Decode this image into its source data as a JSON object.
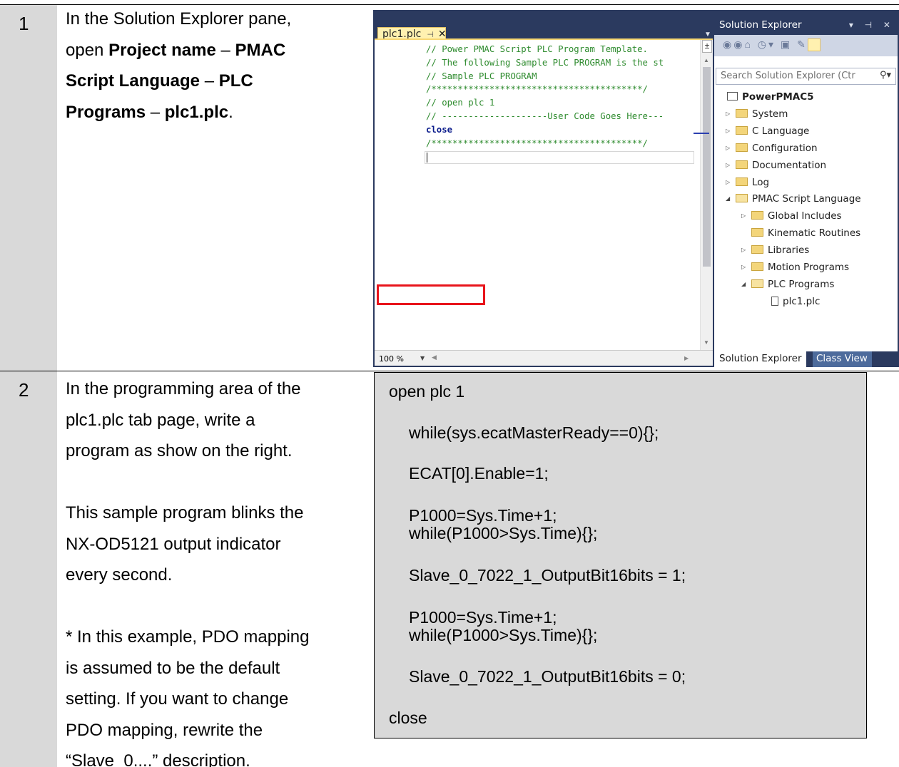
{
  "steps": [
    {
      "number": "1",
      "text_line1": "In the Solution Explorer pane,",
      "text_line2_pre": "open ",
      "text_line2_bold": "Project name",
      "text_sep1": " – ",
      "text_bold2": "PMAC",
      "text_line3_bold": "Script Language",
      "text_sep2": " – ",
      "text_bold3": "PLC",
      "text_line4_bold1": "Programs",
      "text_sep3": " – ",
      "text_line4_bold2": "plc1.plc",
      "text_line4_end": "."
    },
    {
      "number": "2",
      "lines": [
        "In the programming area of the",
        "plc1.plc tab page, write a",
        "program as show on the right.",
        "",
        "This sample program blinks the",
        "NX-OD5121 output indicator",
        "every second.",
        "",
        "* In this example, PDO mapping",
        "is assumed to be the default",
        "setting. If you want to change",
        "PDO mapping, rewrite the",
        "“Slave_0....” description."
      ]
    }
  ],
  "ide": {
    "tab_label": "plc1.plc",
    "tab_pin": "⊣",
    "tab_close": "✕",
    "code_lines": [
      {
        "text": "// Power PMAC Script PLC Program Template.",
        "kind": "c"
      },
      {
        "text": "// The following Sample PLC PROGRAM is the st",
        "kind": "c"
      },
      {
        "text": "// Sample PLC PROGRAM",
        "kind": "c"
      },
      {
        "text": "/****************************************/",
        "kind": "c"
      },
      {
        "text": "// open plc 1",
        "kind": "c"
      },
      {
        "text": "// --------------------User Code Goes Here---",
        "kind": "c"
      },
      {
        "text": "close",
        "kind": "k"
      },
      {
        "text": "/****************************************/",
        "kind": "c"
      }
    ],
    "zoom": "100 %",
    "solution_explorer_title": "Solution Explorer",
    "search_placeholder": "Search Solution Explorer (Ctr",
    "tree": [
      {
        "label": "PowerPMAC5",
        "indent": 0,
        "type": "solution",
        "bold": true
      },
      {
        "label": "System",
        "indent": 1,
        "type": "folder",
        "arrow": "closed"
      },
      {
        "label": "C Language",
        "indent": 1,
        "type": "folder",
        "arrow": "closed"
      },
      {
        "label": "Configuration",
        "indent": 1,
        "type": "folder",
        "arrow": "closed"
      },
      {
        "label": "Documentation",
        "indent": 1,
        "type": "folder",
        "arrow": "closed"
      },
      {
        "label": "Log",
        "indent": 1,
        "type": "folder",
        "arrow": "closed"
      },
      {
        "label": "PMAC Script Language",
        "indent": 1,
        "type": "folder-open",
        "arrow": "open"
      },
      {
        "label": "Global Includes",
        "indent": 2,
        "type": "folder",
        "arrow": "closed"
      },
      {
        "label": "Kinematic Routines",
        "indent": 2,
        "type": "folder",
        "arrow": "none"
      },
      {
        "label": "Libraries",
        "indent": 2,
        "type": "folder",
        "arrow": "closed"
      },
      {
        "label": "Motion Programs",
        "indent": 2,
        "type": "folder",
        "arrow": "closed"
      },
      {
        "label": "PLC Programs",
        "indent": 2,
        "type": "folder-open",
        "arrow": "open"
      },
      {
        "label": "plc1.plc",
        "indent": 3,
        "type": "file",
        "arrow": "none"
      }
    ],
    "bottom_tab_active": "Solution Explorer",
    "bottom_tab_other": "Class View",
    "highlight_color": "#e8141b"
  },
  "program": [
    "open plc 1",
    "while(sys.ecatMasterReady==0){};",
    "ECAT[0].Enable=1;",
    "P1000=Sys.Time+1;",
    "while(P1000>Sys.Time){};",
    "Slave_0_7022_1_OutputBit16bits = 1;",
    "P1000=Sys.Time+1;",
    "while(P1000>Sys.Time){};",
    "Slave_0_7022_1_OutputBit16bits = 0;",
    "close"
  ]
}
